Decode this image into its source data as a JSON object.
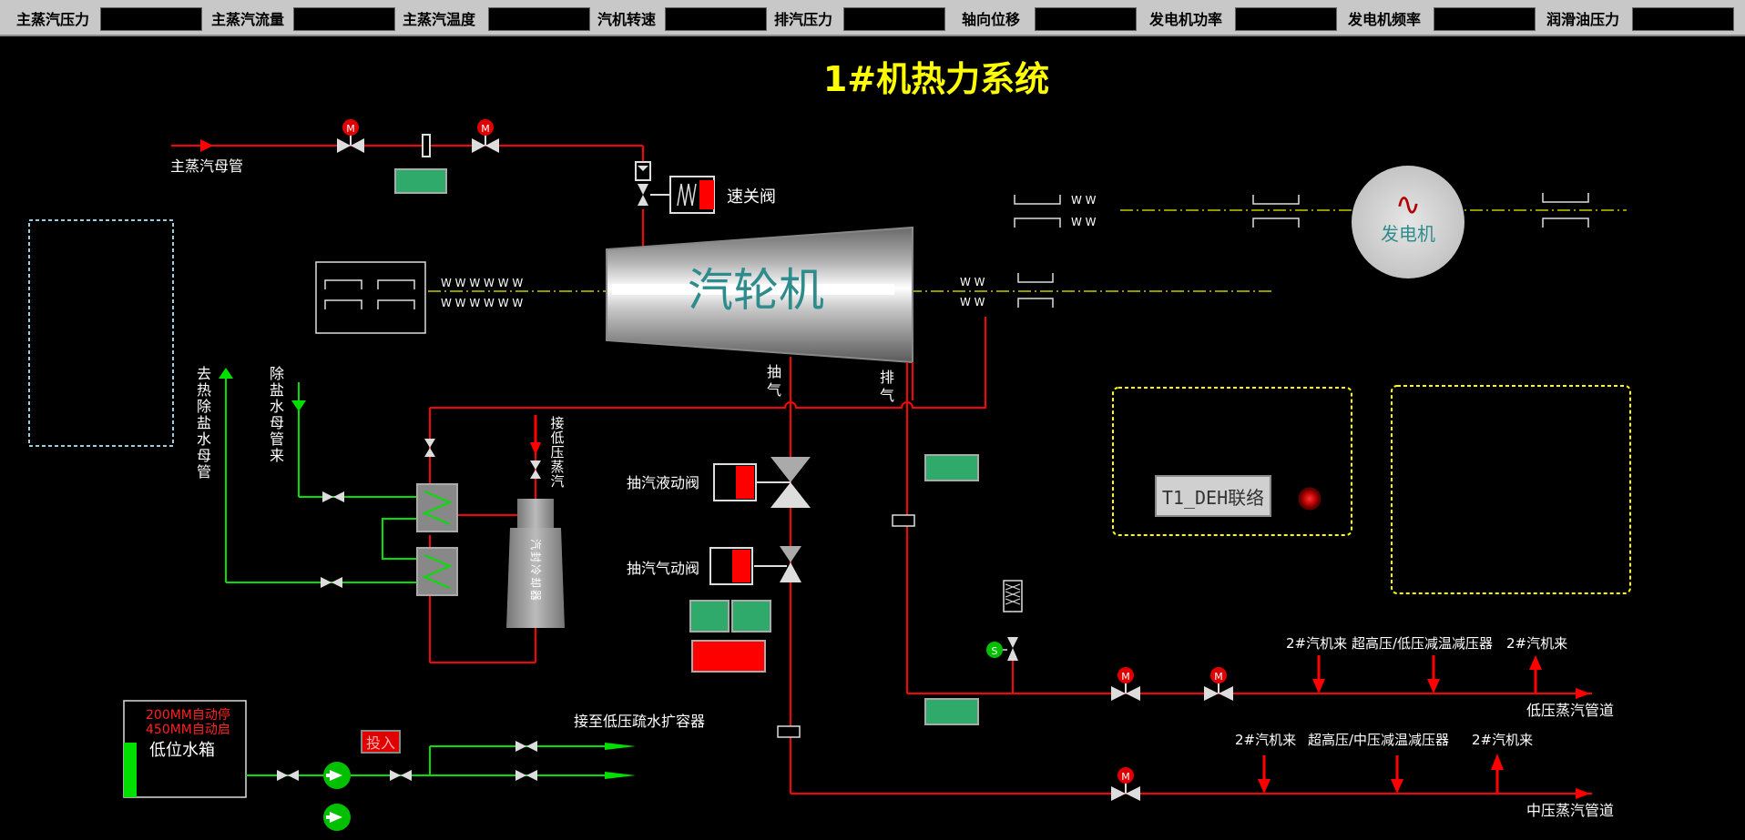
{
  "topbar": {
    "items": [
      {
        "label": "主蒸汽压力",
        "value": ""
      },
      {
        "label": "主蒸汽流量",
        "value": ""
      },
      {
        "label": "主蒸汽温度",
        "value": ""
      },
      {
        "label": "汽机转速",
        "value": ""
      },
      {
        "label": "排汽压力",
        "value": ""
      },
      {
        "label": "轴向位移",
        "value": ""
      },
      {
        "label": "发电机功率",
        "value": ""
      },
      {
        "label": "发电机频率",
        "value": ""
      },
      {
        "label": "润滑油压力",
        "value": ""
      }
    ]
  },
  "title": "1#机热力系统",
  "labels": {
    "main_steam_header": "主蒸汽母管",
    "quick_close_valve": "速关阀",
    "turbine": "汽轮机",
    "generator": "发电机",
    "generator_symbol": "∿",
    "extraction": "抽气",
    "exhaust": "排气",
    "to_deaerator": "去热除盐水母管",
    "from_demin": "除盐水母管来",
    "low_pressure_steam_in": "接低压蒸汽",
    "gland_cooler": "汽封冷却器",
    "extraction_hydraulic_valve": "抽汽液动阀",
    "extraction_pneumatic_valve": "抽汽气动阀",
    "low_level_tank": "低位水箱",
    "tank_note_stop": "200MM自动停",
    "tank_note_start": "450MM自动启",
    "to_drain_expander": "接至低压疏水扩容器",
    "lp_from_2": "2#汽机来",
    "lp_desuperheater": "超高压/低压减温减压器",
    "lp_to_2": "2#汽机来",
    "lp_pipeline": "低压蒸汽管道",
    "mp_from_2": "2#汽机来",
    "mp_desuperheater": "超高压/中压减温减压器",
    "mp_to_2": "2#汽机来",
    "mp_pipeline": "中压蒸汽管道",
    "motor_valve_mark": "M",
    "steam_trap_mark": "S"
  },
  "buttons": {
    "deh_link": "T1_DEH联络",
    "touru": "投入"
  },
  "colors": {
    "steam_pipe": "#ff0000",
    "water_pipe": "#00e000",
    "title": "#ffff00",
    "indicator_green": "#2faa6a",
    "indicator_red": "#ff0000",
    "shaft_line": "#c8c800"
  }
}
